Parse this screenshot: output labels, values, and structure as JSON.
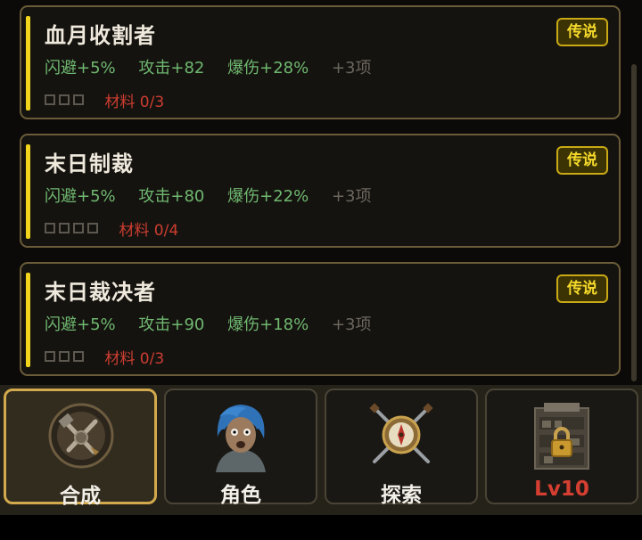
{
  "items": [
    {
      "name": "血月收割者",
      "badge": "传说",
      "stats": [
        "闪避+5%",
        "攻击+82",
        "爆伤+28%"
      ],
      "more": "+3项",
      "material": "材料 0/3",
      "slots": 3
    },
    {
      "name": "末日制裁",
      "badge": "传说",
      "stats": [
        "闪避+5%",
        "攻击+80",
        "爆伤+22%"
      ],
      "more": "+3项",
      "material": "材料 0/4",
      "slots": 4
    },
    {
      "name": "末日裁决者",
      "badge": "传说",
      "stats": [
        "闪避+5%",
        "攻击+90",
        "爆伤+18%"
      ],
      "more": "+3项",
      "material": "材料 0/3",
      "slots": 3
    }
  ],
  "nav": {
    "tabs": [
      {
        "label": "合成",
        "icon": "crafting-gear-icon",
        "active": true
      },
      {
        "label": "角色",
        "icon": "character-portrait-icon",
        "active": false
      },
      {
        "label": "探索",
        "icon": "compass-swords-icon",
        "active": false
      },
      {
        "label": "Lv10",
        "icon": "locked-shop-icon",
        "active": false
      }
    ]
  },
  "colors": {
    "accent": "#f1d41b",
    "stat": "#6fb870",
    "material": "#cc3d31",
    "badge": "#f4d92a",
    "locked": "#d53f32"
  }
}
